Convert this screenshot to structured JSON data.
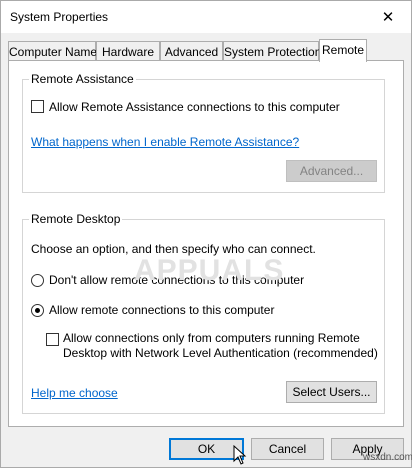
{
  "window": {
    "title": "System Properties",
    "close_glyph": "✕"
  },
  "tabs": [
    {
      "label": "Computer Name",
      "active": false
    },
    {
      "label": "Hardware",
      "active": false
    },
    {
      "label": "Advanced",
      "active": false
    },
    {
      "label": "System Protection",
      "active": false
    },
    {
      "label": "Remote",
      "active": true
    }
  ],
  "remote_assistance": {
    "group_label": "Remote Assistance",
    "allow_label": "Allow Remote Assistance connections to this computer",
    "allow_checked": false,
    "help_link": "What happens when I enable Remote Assistance?",
    "advanced_button": "Advanced..."
  },
  "remote_desktop": {
    "group_label": "Remote Desktop",
    "instruction": "Choose an option, and then specify who can connect.",
    "option_dont_allow": "Don't allow remote connections to this computer",
    "option_allow": "Allow remote connections to this computer",
    "selected_option": "allow",
    "nla_label_line1": "Allow connections only from computers running Remote",
    "nla_label_line2": "Desktop with Network Level Authentication (recommended)",
    "nla_checked": false,
    "help_link": "Help me choose",
    "select_users_button": "Select Users..."
  },
  "footer": {
    "ok": "OK",
    "cancel": "Cancel",
    "apply": "Apply"
  },
  "watermark": "APPUALS",
  "source_mark": "wsxdn.com"
}
